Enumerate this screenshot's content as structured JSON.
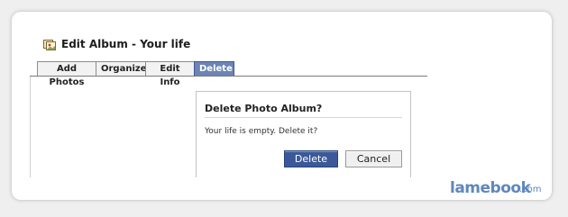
{
  "header": {
    "title": "Edit Album - Your life",
    "icon": "photo-album-icon"
  },
  "tabs": [
    {
      "label": "Add Photos",
      "active": false
    },
    {
      "label": "Organize",
      "active": false
    },
    {
      "label": "Edit Info",
      "active": false
    },
    {
      "label": "Delete",
      "active": true
    }
  ],
  "dialog": {
    "title": "Delete Photo Album?",
    "message": "Your life is empty. Delete it?",
    "confirm_label": "Delete",
    "cancel_label": "Cancel"
  },
  "watermark": {
    "brand": "lamebook",
    "suffix": ".com"
  },
  "colors": {
    "brand_blue": "#3b5998",
    "active_tab": "#6d84b4",
    "watermark": "#5f87bd"
  }
}
